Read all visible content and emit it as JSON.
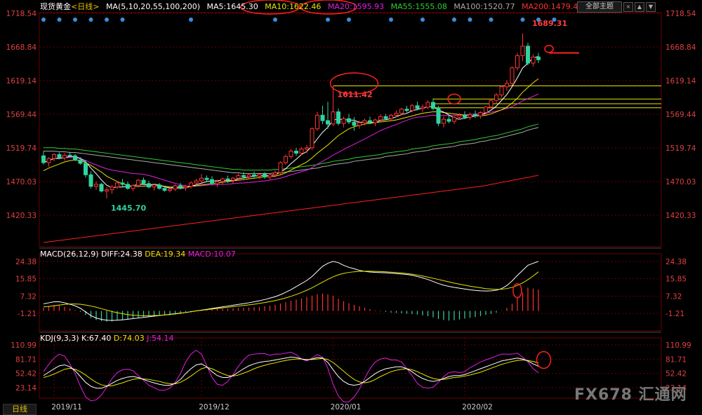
{
  "header": {
    "title": "现货黄金",
    "period": "<日线>",
    "ma_label": "MA(5,10,20,55,100,200)",
    "ma5": "MA5:1645.30",
    "ma10": "MA10:1622.46",
    "ma20": "MA20:1595.93",
    "ma55": "MA55:1555.08",
    "ma100": "MA100:1520.77",
    "ma200": "MA200:1479.43",
    "theme_button": "全部主题",
    "tool_x": "×",
    "tool_up": "▲",
    "tool_down": "▼"
  },
  "macd_header": {
    "name": "MACD(26,12,9)",
    "diff": "DIFF:24.38",
    "dea": "DEA:19.34",
    "macd": "MACD:10.07"
  },
  "kdj_header": {
    "name": "KDJ(9,3,3)",
    "k": "K:67.40",
    "d": "D:74.03",
    "j": "J:54.14"
  },
  "period_tab": "日线",
  "watermark": "FX678 汇通网",
  "chart_data": {
    "type": "candlestick",
    "price_axis_ticks": [
      "1718.54",
      "1668.84",
      "1619.14",
      "1569.44",
      "1519.74",
      "1470.03",
      "1420.33"
    ],
    "macd_axis_ticks": [
      "24.38",
      "15.85",
      "7.32",
      "-1.21"
    ],
    "kdj_axis_ticks": [
      "110.99",
      "81.71",
      "52.42",
      "23.14"
    ],
    "x_ticks": [
      "2019/11",
      "2019/12",
      "2020/01",
      "2020/02"
    ],
    "annotations": [
      "1689.31",
      "1611.42",
      "1445.70"
    ],
    "horizontal_levels": [
      1611.42,
      1592,
      1585,
      1579
    ],
    "colors": {
      "up": "#ff3333",
      "down": "#2fd4a0",
      "ma5": "#ffffff",
      "ma10": "#e6e600",
      "ma20": "#e020e0",
      "ma55": "#30cc30",
      "ma100": "#aaaaaa",
      "ma200": "#ff2020",
      "grid": "#6b0000"
    },
    "candles": [
      [
        1508,
        1515,
        1495,
        1498
      ],
      [
        1498,
        1506,
        1492,
        1504
      ],
      [
        1504,
        1512,
        1500,
        1510
      ],
      [
        1510,
        1513,
        1503,
        1505
      ],
      [
        1505,
        1512,
        1501,
        1509
      ],
      [
        1509,
        1514,
        1506,
        1508
      ],
      [
        1508,
        1511,
        1500,
        1502
      ],
      [
        1502,
        1506,
        1495,
        1497
      ],
      [
        1497,
        1502,
        1476,
        1480
      ],
      [
        1480,
        1485,
        1460,
        1463
      ],
      [
        1463,
        1470,
        1458,
        1466
      ],
      [
        1466,
        1468,
        1454,
        1456
      ],
      [
        1456,
        1462,
        1445,
        1458
      ],
      [
        1458,
        1465,
        1452,
        1462
      ],
      [
        1462,
        1470,
        1459,
        1468
      ],
      [
        1468,
        1474,
        1463,
        1466
      ],
      [
        1466,
        1470,
        1458,
        1460
      ],
      [
        1460,
        1466,
        1456,
        1464
      ],
      [
        1464,
        1474,
        1461,
        1472
      ],
      [
        1472,
        1476,
        1465,
        1467
      ],
      [
        1467,
        1471,
        1460,
        1462
      ],
      [
        1462,
        1466,
        1457,
        1465
      ],
      [
        1465,
        1468,
        1458,
        1460
      ],
      [
        1460,
        1464,
        1455,
        1457
      ],
      [
        1457,
        1462,
        1454,
        1459
      ],
      [
        1459,
        1466,
        1456,
        1464
      ],
      [
        1464,
        1468,
        1458,
        1461
      ],
      [
        1461,
        1465,
        1456,
        1463
      ],
      [
        1463,
        1470,
        1460,
        1468
      ],
      [
        1468,
        1474,
        1465,
        1471
      ],
      [
        1471,
        1481,
        1468,
        1475
      ],
      [
        1475,
        1479,
        1469,
        1473
      ],
      [
        1473,
        1478,
        1465,
        1467
      ],
      [
        1467,
        1473,
        1462,
        1470
      ],
      [
        1470,
        1476,
        1466,
        1474
      ],
      [
        1474,
        1479,
        1468,
        1472
      ],
      [
        1472,
        1477,
        1467,
        1475
      ],
      [
        1475,
        1482,
        1472,
        1479
      ],
      [
        1479,
        1484,
        1474,
        1477
      ],
      [
        1477,
        1482,
        1473,
        1480
      ],
      [
        1480,
        1485,
        1475,
        1478
      ],
      [
        1478,
        1483,
        1474,
        1481
      ],
      [
        1481,
        1484,
        1474,
        1477
      ],
      [
        1477,
        1482,
        1473,
        1480
      ],
      [
        1480,
        1487,
        1476,
        1483
      ],
      [
        1483,
        1500,
        1480,
        1498
      ],
      [
        1498,
        1510,
        1495,
        1507
      ],
      [
        1507,
        1518,
        1504,
        1515
      ],
      [
        1515,
        1520,
        1508,
        1512
      ],
      [
        1512,
        1521,
        1509,
        1518
      ],
      [
        1518,
        1524,
        1512,
        1520
      ],
      [
        1520,
        1550,
        1517,
        1548
      ],
      [
        1548,
        1573,
        1545,
        1568
      ],
      [
        1568,
        1582,
        1555,
        1560
      ],
      [
        1560,
        1588,
        1548,
        1555
      ],
      [
        1555,
        1611,
        1552,
        1573
      ],
      [
        1573,
        1578,
        1553,
        1556
      ],
      [
        1556,
        1566,
        1550,
        1563
      ],
      [
        1563,
        1570,
        1555,
        1558
      ],
      [
        1558,
        1565,
        1545,
        1553
      ],
      [
        1553,
        1560,
        1548,
        1557
      ],
      [
        1557,
        1563,
        1553,
        1560
      ],
      [
        1560,
        1566,
        1555,
        1557
      ],
      [
        1557,
        1563,
        1552,
        1561
      ],
      [
        1561,
        1569,
        1558,
        1566
      ],
      [
        1566,
        1570,
        1560,
        1563
      ],
      [
        1563,
        1570,
        1559,
        1568
      ],
      [
        1568,
        1575,
        1565,
        1571
      ],
      [
        1571,
        1579,
        1568,
        1577
      ],
      [
        1577,
        1582,
        1572,
        1575
      ],
      [
        1575,
        1585,
        1572,
        1582
      ],
      [
        1582,
        1588,
        1575,
        1578
      ],
      [
        1578,
        1584,
        1573,
        1580
      ],
      [
        1580,
        1590,
        1577,
        1587
      ],
      [
        1587,
        1593,
        1575,
        1578
      ],
      [
        1578,
        1582,
        1552,
        1556
      ],
      [
        1556,
        1566,
        1550,
        1562
      ],
      [
        1562,
        1568,
        1556,
        1559
      ],
      [
        1559,
        1567,
        1555,
        1565
      ],
      [
        1565,
        1571,
        1561,
        1568
      ],
      [
        1568,
        1574,
        1562,
        1565
      ],
      [
        1565,
        1572,
        1561,
        1569
      ],
      [
        1569,
        1575,
        1564,
        1567
      ],
      [
        1567,
        1574,
        1563,
        1572
      ],
      [
        1572,
        1582,
        1570,
        1580
      ],
      [
        1580,
        1592,
        1578,
        1590
      ],
      [
        1590,
        1601,
        1586,
        1598
      ],
      [
        1598,
        1612,
        1594,
        1610
      ],
      [
        1610,
        1620,
        1604,
        1615
      ],
      [
        1615,
        1640,
        1612,
        1638
      ],
      [
        1638,
        1660,
        1634,
        1656
      ],
      [
        1656,
        1689,
        1648,
        1670
      ],
      [
        1670,
        1675,
        1642,
        1645
      ],
      [
        1645,
        1658,
        1640,
        1654
      ],
      [
        1654,
        1660,
        1645,
        1650
      ]
    ],
    "ma10": [
      1486,
      1490,
      1493,
      1496,
      1499,
      1501,
      1502,
      1501,
      1498,
      1494,
      1489,
      1484,
      1478,
      1474,
      1470,
      1467,
      1464,
      1463,
      1463,
      1463,
      1464,
      1464,
      1464,
      1463,
      1462,
      1462,
      1462,
      1462,
      1463,
      1464,
      1465,
      1466,
      1467,
      1468,
      1469,
      1470,
      1471,
      1472,
      1473,
      1474,
      1475,
      1476,
      1477,
      1477,
      1478,
      1480,
      1483,
      1487,
      1491,
      1495,
      1499,
      1505,
      1512,
      1518,
      1524,
      1531,
      1538,
      1543,
      1548,
      1551,
      1553,
      1555,
      1556,
      1557,
      1558,
      1559,
      1560,
      1561,
      1563,
      1565,
      1567,
      1569,
      1571,
      1572,
      1573,
      1573,
      1572,
      1571,
      1570,
      1569,
      1568,
      1568,
      1567,
      1567,
      1568,
      1570,
      1573,
      1576,
      1580,
      1586,
      1593,
      1602,
      1609,
      1616,
      1622
    ],
    "ma55": [
      1520,
      1520,
      1520,
      1519,
      1519,
      1518,
      1518,
      1517,
      1516,
      1515,
      1514,
      1513,
      1512,
      1511,
      1510,
      1509,
      1508,
      1507,
      1506,
      1505,
      1504,
      1503,
      1502,
      1501,
      1500,
      1499,
      1498,
      1497,
      1496,
      1495,
      1494,
      1493,
      1492,
      1491,
      1490,
      1489,
      1488,
      1488,
      1487,
      1487,
      1487,
      1487,
      1487,
      1487,
      1488,
      1488,
      1489,
      1490,
      1491,
      1492,
      1493,
      1494,
      1495,
      1497,
      1498,
      1500,
      1501,
      1502,
      1503,
      1505,
      1506,
      1507,
      1508,
      1509,
      1510,
      1512,
      1513,
      1514,
      1515,
      1516,
      1518,
      1519,
      1520,
      1521,
      1523,
      1524,
      1525,
      1526,
      1527,
      1529,
      1530,
      1531,
      1532,
      1534,
      1535,
      1537,
      1538,
      1540,
      1542,
      1544,
      1546,
      1548,
      1551,
      1553,
      1555
    ],
    "ma200": [
      1380,
      1381,
      1382,
      1383,
      1384,
      1385,
      1386,
      1387,
      1388,
      1389,
      1390,
      1391,
      1392,
      1393,
      1394,
      1395,
      1396,
      1397,
      1398,
      1399,
      1400,
      1401,
      1402,
      1403,
      1404,
      1405,
      1406,
      1407,
      1408,
      1409,
      1410,
      1411,
      1412,
      1413,
      1414,
      1415,
      1416,
      1417,
      1418,
      1419,
      1420,
      1421,
      1422,
      1423,
      1424,
      1425,
      1426,
      1427,
      1428,
      1429,
      1430,
      1431,
      1432,
      1433,
      1434,
      1435,
      1436,
      1437,
      1438,
      1439,
      1440,
      1441,
      1442,
      1443,
      1444,
      1445,
      1446,
      1447,
      1448,
      1449,
      1450,
      1451,
      1452,
      1453,
      1454,
      1455,
      1456,
      1457,
      1458,
      1459,
      1460,
      1461,
      1462,
      1463,
      1464,
      1466,
      1467,
      1469,
      1470,
      1472,
      1473,
      1475,
      1476,
      1478,
      1479
    ],
    "macd_hist": [
      1.5,
      2.5,
      3.0,
      2.6,
      2.0,
      1.2,
      0.4,
      -0.5,
      -2.0,
      -3.5,
      -4.5,
      -5.0,
      -5.3,
      -5.2,
      -4.8,
      -4.4,
      -4.0,
      -3.7,
      -3.3,
      -3.0,
      -2.7,
      -2.4,
      -2.2,
      -2.0,
      -1.8,
      -1.6,
      -1.3,
      -1.0,
      -0.6,
      -0.2,
      0.2,
      0.5,
      0.8,
      1.0,
      1.1,
      1.2,
      1.3,
      1.4,
      1.5,
      1.6,
      1.8,
      2.0,
      2.3,
      2.6,
      3.0,
      3.6,
      4.3,
      5.0,
      5.6,
      6.2,
      6.8,
      7.5,
      8.2,
      8.6,
      8.2,
      7.5,
      6.0,
      4.8,
      3.8,
      3.0,
      2.3,
      1.6,
      0.9,
      0.3,
      -0.2,
      -0.5,
      -0.8,
      -1.0,
      -1.2,
      -1.4,
      -1.6,
      -1.8,
      -2.2,
      -2.6,
      -3.2,
      -4.0,
      -4.5,
      -4.8,
      -4.6,
      -4.2,
      -3.8,
      -3.4,
      -3.0,
      -2.5,
      -2.0,
      -1.5,
      -0.8,
      0.2,
      1.5,
      3.5,
      6.5,
      9.0,
      11.5,
      11.0,
      10.5
    ],
    "macd_diff": [
      3.5,
      4.0,
      4.5,
      4.5,
      4.0,
      3.3,
      2.5,
      1.3,
      -0.5,
      -2.3,
      -3.5,
      -4.2,
      -4.6,
      -4.7,
      -4.6,
      -4.4,
      -4.1,
      -3.8,
      -3.5,
      -3.2,
      -2.9,
      -2.6,
      -2.3,
      -2.0,
      -1.7,
      -1.4,
      -1.1,
      -0.8,
      -0.4,
      0.0,
      0.4,
      0.8,
      1.2,
      1.6,
      2.0,
      2.4,
      2.8,
      3.2,
      3.6,
      4.0,
      4.5,
      5.0,
      5.6,
      6.3,
      7.0,
      8.0,
      9.2,
      10.5,
      12.0,
      13.5,
      15.0,
      17.0,
      19.5,
      22.0,
      23.5,
      24.4,
      23.8,
      22.5,
      21.5,
      20.8,
      20.0,
      19.5,
      19.2,
      19.0,
      18.9,
      18.8,
      18.6,
      18.4,
      18.2,
      18.0,
      17.6,
      17.0,
      16.3,
      15.5,
      14.5,
      13.5,
      12.7,
      12.1,
      11.6,
      11.2,
      10.8,
      10.4,
      10.1,
      9.9,
      9.8,
      9.9,
      10.2,
      11.0,
      12.5,
      14.8,
      17.5,
      20.0,
      22.5,
      23.5,
      24.4
    ],
    "macd_dea": [
      2.0,
      2.2,
      2.5,
      2.9,
      3.2,
      3.4,
      3.4,
      3.3,
      2.9,
      2.4,
      1.8,
      1.1,
      0.4,
      -0.3,
      -0.9,
      -1.4,
      -1.8,
      -2.1,
      -2.3,
      -2.4,
      -2.4,
      -2.3,
      -2.2,
      -2.0,
      -1.8,
      -1.5,
      -1.2,
      -0.8,
      -0.4,
      0.0,
      0.3,
      0.6,
      0.9,
      1.2,
      1.5,
      1.8,
      2.1,
      2.4,
      2.7,
      3.0,
      3.3,
      3.7,
      4.1,
      4.6,
      5.1,
      5.7,
      6.4,
      7.2,
      8.1,
      9.1,
      10.2,
      11.4,
      12.8,
      14.2,
      15.6,
      16.8,
      17.8,
      18.5,
      19.0,
      19.3,
      19.5,
      19.6,
      19.6,
      19.5,
      19.4,
      19.3,
      19.1,
      18.9,
      18.7,
      18.4,
      18.1,
      17.7,
      17.2,
      16.7,
      16.1,
      15.5,
      14.9,
      14.3,
      13.7,
      13.2,
      12.7,
      12.2,
      11.8,
      11.4,
      11.0,
      10.8,
      10.6,
      10.7,
      11.0,
      11.6,
      12.6,
      13.8,
      15.4,
      17.2,
      19.3
    ],
    "kdj_k": [
      48,
      55,
      62,
      68,
      70,
      66,
      58,
      46,
      34,
      26,
      22,
      22,
      26,
      32,
      38,
      42,
      45,
      46,
      44,
      40,
      36,
      33,
      30,
      28,
      28,
      32,
      40,
      52,
      62,
      70,
      72,
      66,
      56,
      48,
      44,
      44,
      48,
      55,
      62,
      68,
      72,
      75,
      77,
      78,
      80,
      82,
      84,
      86,
      85,
      82,
      80,
      82,
      85,
      84,
      75,
      60,
      46,
      36,
      30,
      28,
      30,
      36,
      44,
      52,
      58,
      62,
      64,
      66,
      66,
      62,
      56,
      48,
      42,
      38,
      36,
      38,
      42,
      46,
      48,
      48,
      50,
      54,
      58,
      62,
      66,
      70,
      74,
      78,
      80,
      82,
      84,
      82,
      78,
      72,
      67
    ],
    "kdj_d": [
      44,
      47,
      51,
      56,
      61,
      63,
      61,
      56,
      49,
      41,
      34,
      29,
      27,
      27,
      30,
      33,
      37,
      40,
      42,
      41,
      40,
      38,
      36,
      33,
      31,
      31,
      34,
      40,
      47,
      55,
      62,
      65,
      62,
      57,
      52,
      48,
      47,
      49,
      53,
      57,
      62,
      66,
      69,
      72,
      74,
      77,
      79,
      81,
      82,
      82,
      81,
      81,
      82,
      83,
      81,
      75,
      66,
      57,
      48,
      40,
      35,
      33,
      35,
      40,
      46,
      51,
      56,
      59,
      61,
      62,
      60,
      56,
      51,
      46,
      42,
      40,
      40,
      42,
      44,
      45,
      47,
      49,
      52,
      55,
      59,
      63,
      67,
      71,
      74,
      77,
      79,
      80,
      79,
      77,
      74
    ],
    "kdj_j": [
      56,
      71,
      84,
      92,
      88,
      72,
      52,
      26,
      4,
      -4,
      -2,
      8,
      24,
      42,
      54,
      60,
      61,
      58,
      48,
      38,
      28,
      23,
      18,
      18,
      22,
      34,
      52,
      76,
      92,
      100,
      92,
      68,
      44,
      30,
      28,
      36,
      50,
      67,
      80,
      90,
      92,
      93,
      93,
      90,
      92,
      92,
      94,
      96,
      91,
      82,
      78,
      84,
      91,
      86,
      63,
      30,
      6,
      -6,
      -6,
      4,
      20,
      42,
      62,
      76,
      82,
      84,
      80,
      80,
      76,
      62,
      48,
      32,
      24,
      22,
      24,
      34,
      46,
      54,
      56,
      54,
      56,
      64,
      70,
      76,
      80,
      84,
      88,
      92,
      92,
      92,
      94,
      86,
      76,
      62,
      54
    ]
  }
}
